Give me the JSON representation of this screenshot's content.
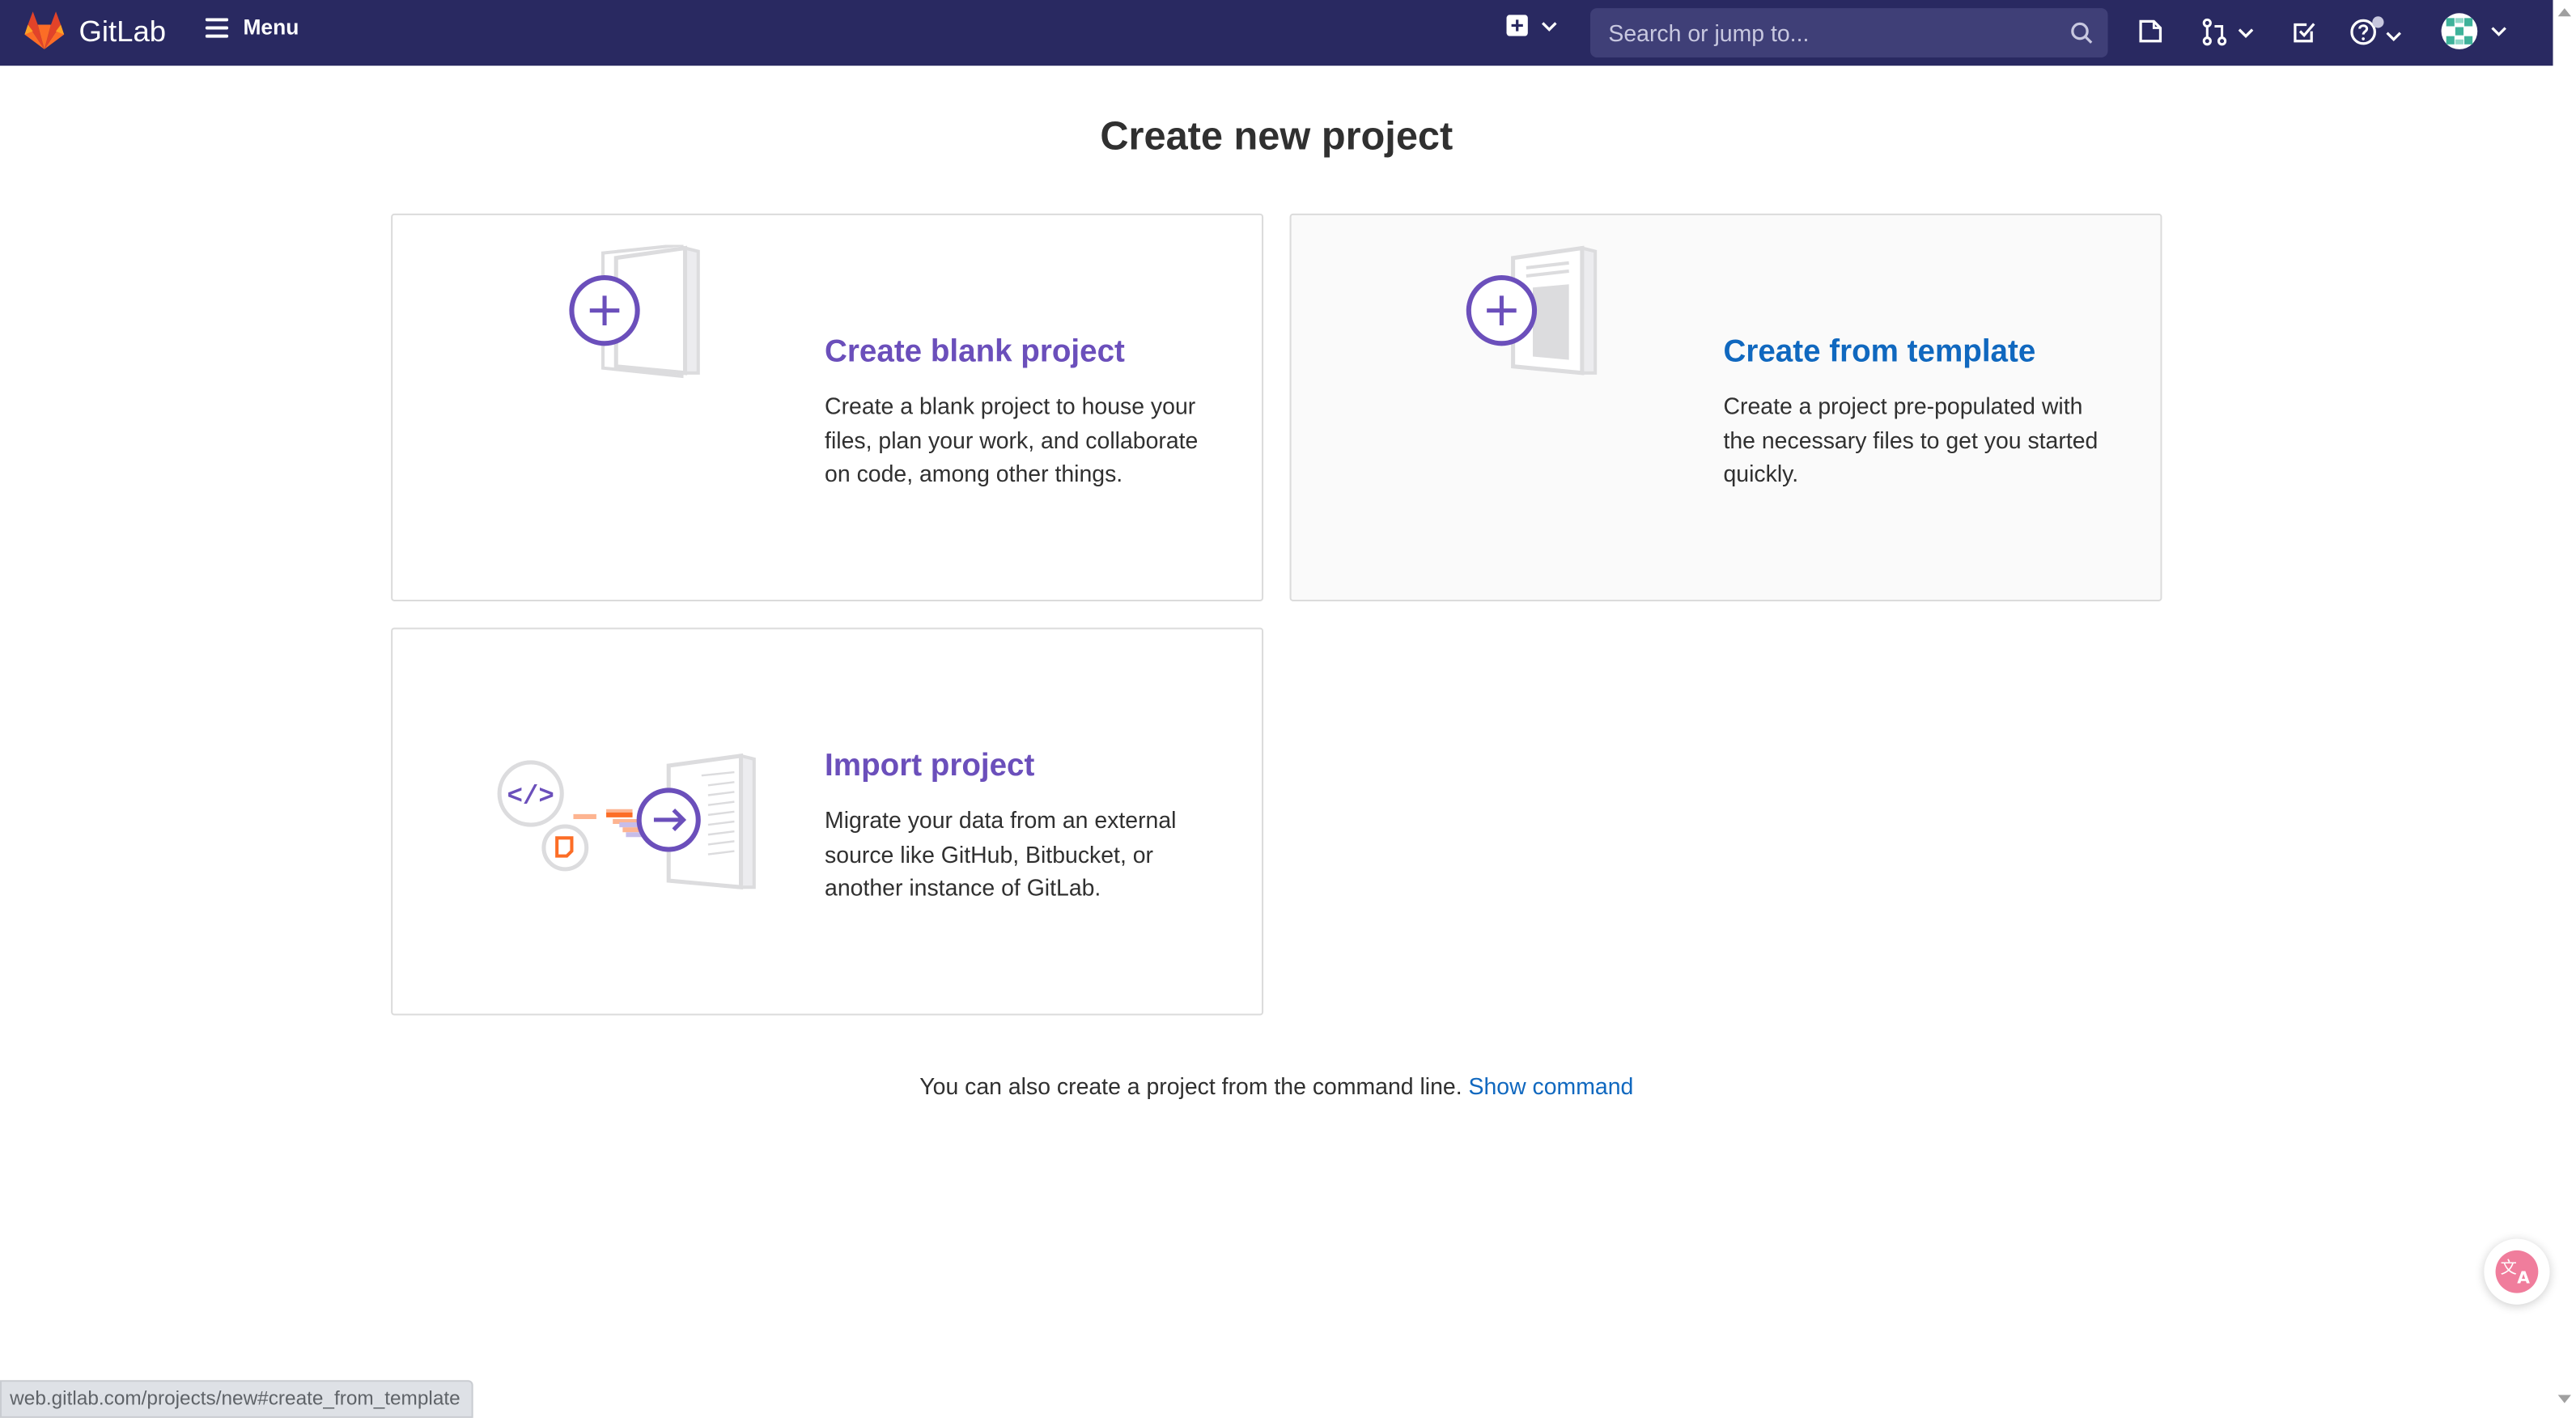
{
  "header": {
    "brand": "GitLab",
    "menu_label": "Menu",
    "search_placeholder": "Search or jump to...",
    "icons": [
      "gitlab-logo",
      "hamburger-icon",
      "new-item-icon",
      "search-icon",
      "issues-icon",
      "merge-requests-icon",
      "todos-icon",
      "help-icon",
      "avatar"
    ]
  },
  "page": {
    "title": "Create new project"
  },
  "cards": [
    {
      "title": "Create blank project",
      "description": "Create a blank project to house your files, plan your work, and collaborate on code, among other things."
    },
    {
      "title": "Create from template",
      "description": "Create a project pre-populated with the necessary files to get you started quickly."
    },
    {
      "title": "Import project",
      "description": "Migrate your data from an external source like GitHub, Bitbucket, or another instance of GitLab."
    }
  ],
  "footnote": {
    "text": "You can also create a project from the command line.",
    "link": "Show command"
  },
  "status_bar": {
    "url": "web.gitlab.com/projects/new#create_from_template"
  },
  "colors": {
    "navbar": "#292961",
    "card_title": "#6b4fbb",
    "link": "#1068bf"
  }
}
